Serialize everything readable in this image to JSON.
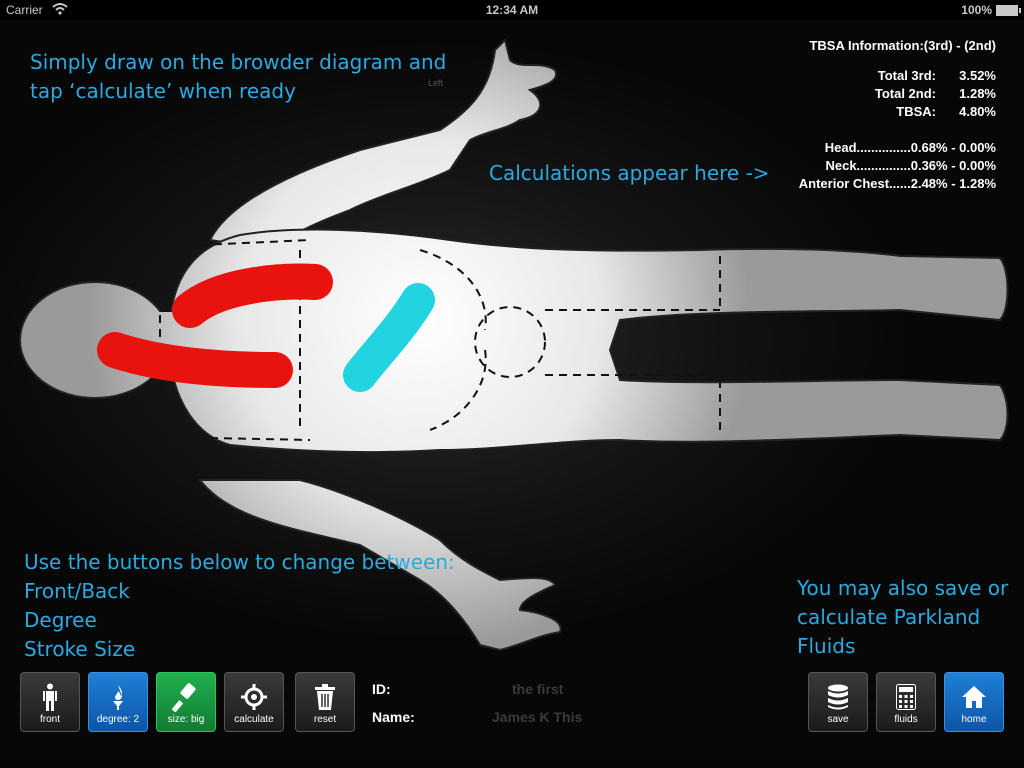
{
  "status_bar": {
    "carrier": "Carrier",
    "time": "12:34 AM",
    "battery": "100%"
  },
  "help": {
    "draw": "Simply draw on the browder diagram and tap ‘calculate’ when ready",
    "calc_here": "Calculations appear here ->",
    "buttons_intro": "Use the buttons below to  change between:",
    "buttons_items": [
      "Front/Back",
      "Degree",
      "Stroke Size"
    ],
    "save": "You may also save or calculate Parkland Fluids"
  },
  "diagram": {
    "side_label": "Left"
  },
  "tbsa": {
    "header": "TBSA Information:(3rd) - (2nd)",
    "totals": [
      {
        "label": "Total 3rd:",
        "value": "3.52%"
      },
      {
        "label": "Total 2nd:",
        "value": "1.28%"
      },
      {
        "label": "TBSA:",
        "value": "4.80%"
      }
    ],
    "regions": [
      "Head...............0.68% - 0.00%",
      "Neck...............0.36% - 0.00%",
      "Anterior Chest......2.48% - 1.28%"
    ]
  },
  "toolbar": {
    "front_label": "front",
    "degree_label": "degree: 2",
    "size_label": "size: big",
    "calculate_label": "calculate",
    "reset_label": "reset",
    "save_label": "save",
    "fluids_label": "fluids",
    "home_label": "home"
  },
  "patient": {
    "id_label": "ID:",
    "id_value": "the first",
    "name_label": "Name:",
    "name_value": "James K This"
  },
  "colors": {
    "accent": "#29abe2",
    "third_degree": "#e8120f",
    "second_degree": "#22d3e0",
    "button_blue": "#1565c0",
    "button_green": "#1e9e45"
  },
  "icons": [
    "wifi-icon",
    "person-icon",
    "flame-icon",
    "brush-icon",
    "gear-icon",
    "trash-icon",
    "database-icon",
    "calculator-icon",
    "home-icon"
  ]
}
